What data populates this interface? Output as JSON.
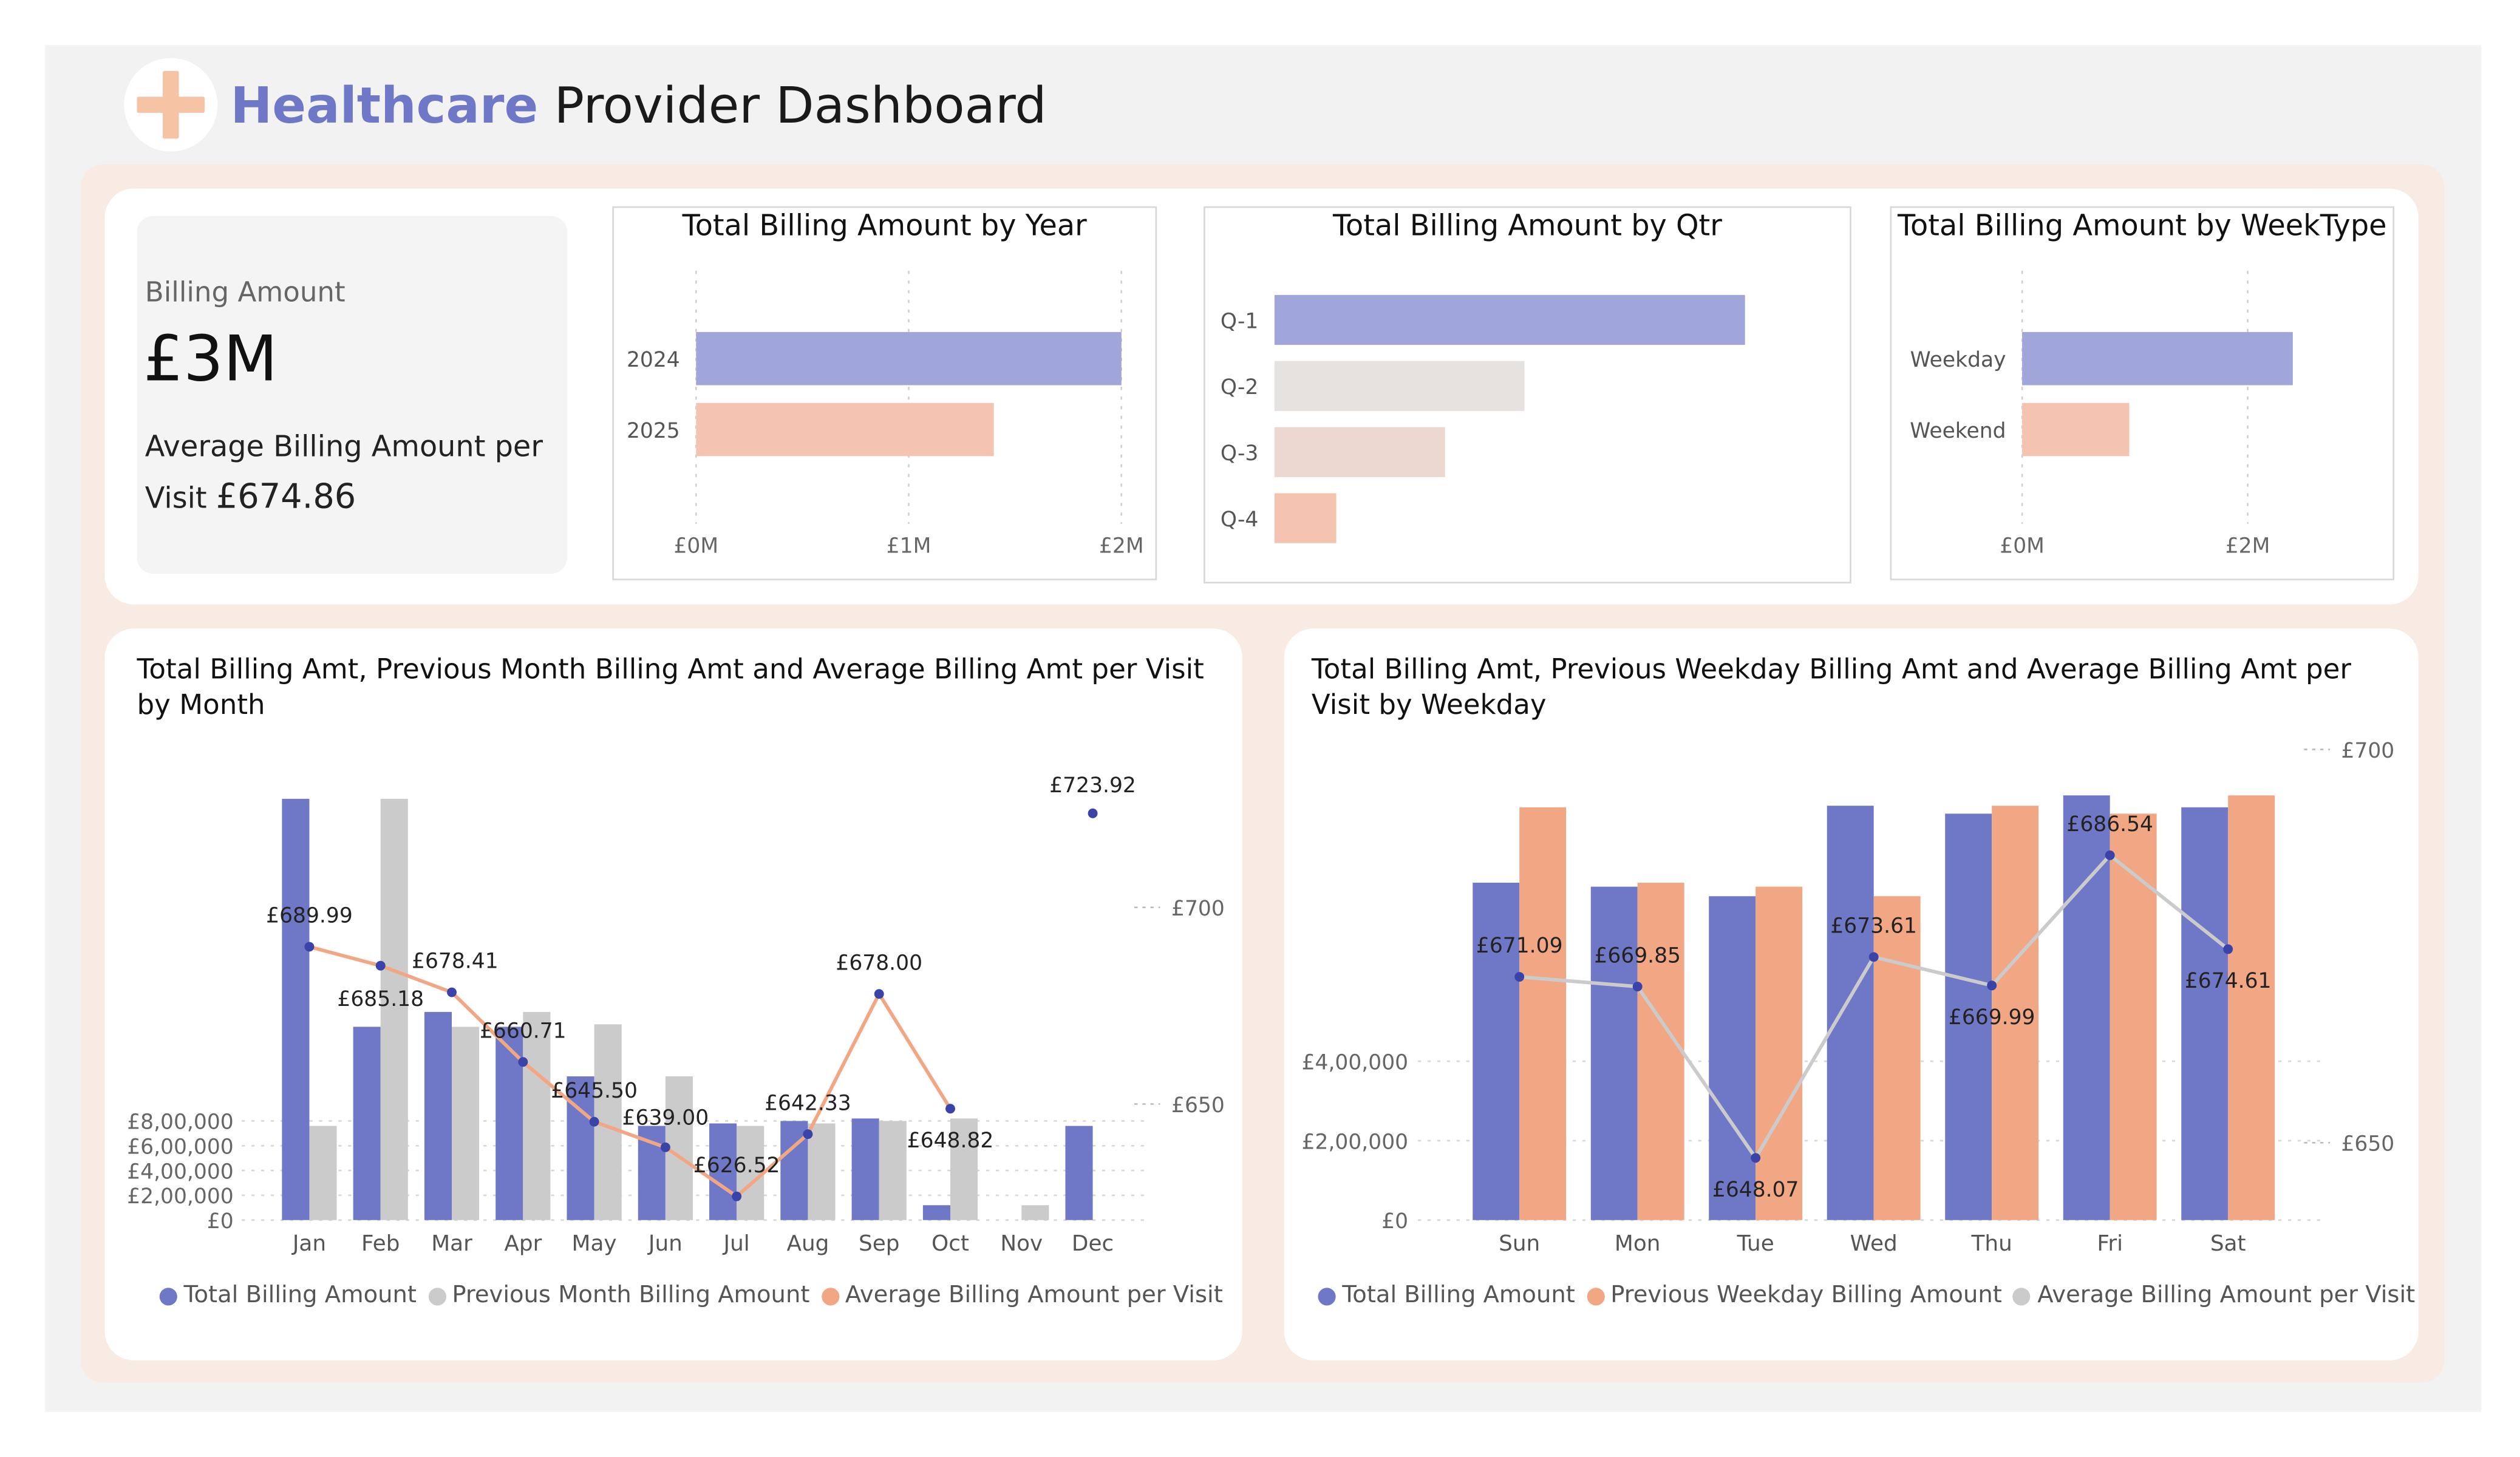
{
  "header": {
    "title_accent": "Healthcare",
    "title_rest": "Provider Dashboard",
    "logo_icon": "plus-icon"
  },
  "colors": {
    "blue": "#6e78c6",
    "blue_light": "#a0a6da",
    "peach": "#f1a784",
    "peach_light": "#f5c4b0",
    "grey": "#cbcbcb"
  },
  "kpi": {
    "label": "Billing Amount",
    "value": "£3M",
    "avg_label": "Average Billing Amount per Visit",
    "avg_value": "£674.86"
  },
  "year_chart": {
    "title": "Total Billing Amount by Year"
  },
  "qtr_chart": {
    "title": "Total Billing Amount by Qtr"
  },
  "week_chart": {
    "title": "Total Billing Amount by WeekType"
  },
  "month_chart": {
    "title": "Total Billing Amt, Previous Month Billing Amt and Average Billing Amt per Visit by Month"
  },
  "weekday_chart": {
    "title": "Total Billing Amt, Previous Weekday Billing Amt and Average Billing Amt per Visit by Weekday"
  },
  "chart_data": [
    {
      "type": "bar",
      "title": "Total Billing Amount by Year",
      "categories": [
        "2024",
        "2025"
      ],
      "values": [
        2000000,
        1400000
      ],
      "xticks": [
        "£0M",
        "£1M",
        "£2M"
      ],
      "xlim": [
        0,
        2000000
      ],
      "grid": true
    },
    {
      "type": "bar",
      "title": "Total Billing Amount by Qtr",
      "categories": [
        "Q-1",
        "Q-2",
        "Q-3",
        "Q-4"
      ],
      "values": [
        1600000,
        850000,
        580000,
        210000
      ],
      "grid": false
    },
    {
      "type": "bar",
      "title": "Total Billing Amount by WeekType",
      "categories": [
        "Weekday",
        "Weekend"
      ],
      "values": [
        2400000,
        950000
      ],
      "xticks": [
        "£0M",
        "£2M"
      ],
      "xlim": [
        0,
        2900000
      ],
      "grid": true
    },
    {
      "type": "bar",
      "title": "Total Billing Amt, Previous Month Billing Amt and Average Billing Amt per Visit by Month",
      "categories": [
        "Jan",
        "Feb",
        "Mar",
        "Apr",
        "May",
        "Jun",
        "Jul",
        "Aug",
        "Sep",
        "Oct",
        "Nov",
        "Dec"
      ],
      "series": [
        {
          "name": "Total Billing Amount",
          "values": [
            850000,
            390000,
            420000,
            390000,
            290000,
            190000,
            195000,
            200000,
            205000,
            30000,
            null,
            190000
          ]
        },
        {
          "name": "Previous Month Billing Amount",
          "values": [
            190000,
            850000,
            390000,
            420000,
            395000,
            290000,
            190000,
            195000,
            200000,
            205000,
            30000,
            null
          ]
        },
        {
          "name": "Average Billing Amount per Visit",
          "axis": "right",
          "values": [
            689.99,
            685.18,
            678.41,
            660.71,
            645.5,
            639.0,
            626.52,
            642.33,
            678.0,
            648.82,
            null,
            723.92
          ],
          "labels": [
            "£689.99",
            "£685.18",
            "£678.41",
            "£660.71",
            "£645.50",
            "£639.00",
            "£626.52",
            "£642.33",
            "£678.00",
            "£648.82",
            "",
            "£723.92"
          ]
        }
      ],
      "yticks": [
        "£0",
        "£2,00,000",
        "£4,00,000",
        "£6,00,000",
        "£8,00,000"
      ],
      "ylim": [
        0,
        800000
      ],
      "y2ticks": [
        "£650",
        "£700"
      ],
      "y2lim": [
        650,
        700
      ],
      "legend": "bottom",
      "grid": true
    },
    {
      "type": "bar",
      "title": "Total Billing Amt, Previous Weekday Billing Amt and Average Billing Amt per Visit by Weekday",
      "categories": [
        "Sun",
        "Mon",
        "Tue",
        "Wed",
        "Thu",
        "Fri",
        "Sat"
      ],
      "series": [
        {
          "name": "Total Billing Amount",
          "values": [
            425000,
            420000,
            408000,
            522000,
            512000,
            535000,
            520000
          ]
        },
        {
          "name": "Previous Weekday Billing Amount",
          "values": [
            520000,
            425000,
            420000,
            408000,
            522000,
            512000,
            535000
          ]
        },
        {
          "name": "Average Billing Amount per Visit",
          "axis": "right",
          "values": [
            671.09,
            669.85,
            648.07,
            673.61,
            669.99,
            686.54,
            674.61
          ],
          "labels": [
            "£671.09",
            "£669.85",
            "£648.07",
            "£673.61",
            "£669.99",
            "£686.54",
            "£674.61"
          ]
        }
      ],
      "yticks": [
        "£0",
        "£2,00,000",
        "£4,00,000"
      ],
      "ylim": [
        0,
        400000
      ],
      "y2ticks": [
        "£650",
        "£700"
      ],
      "y2lim": [
        650,
        700
      ],
      "legend": "bottom",
      "grid": true
    }
  ]
}
